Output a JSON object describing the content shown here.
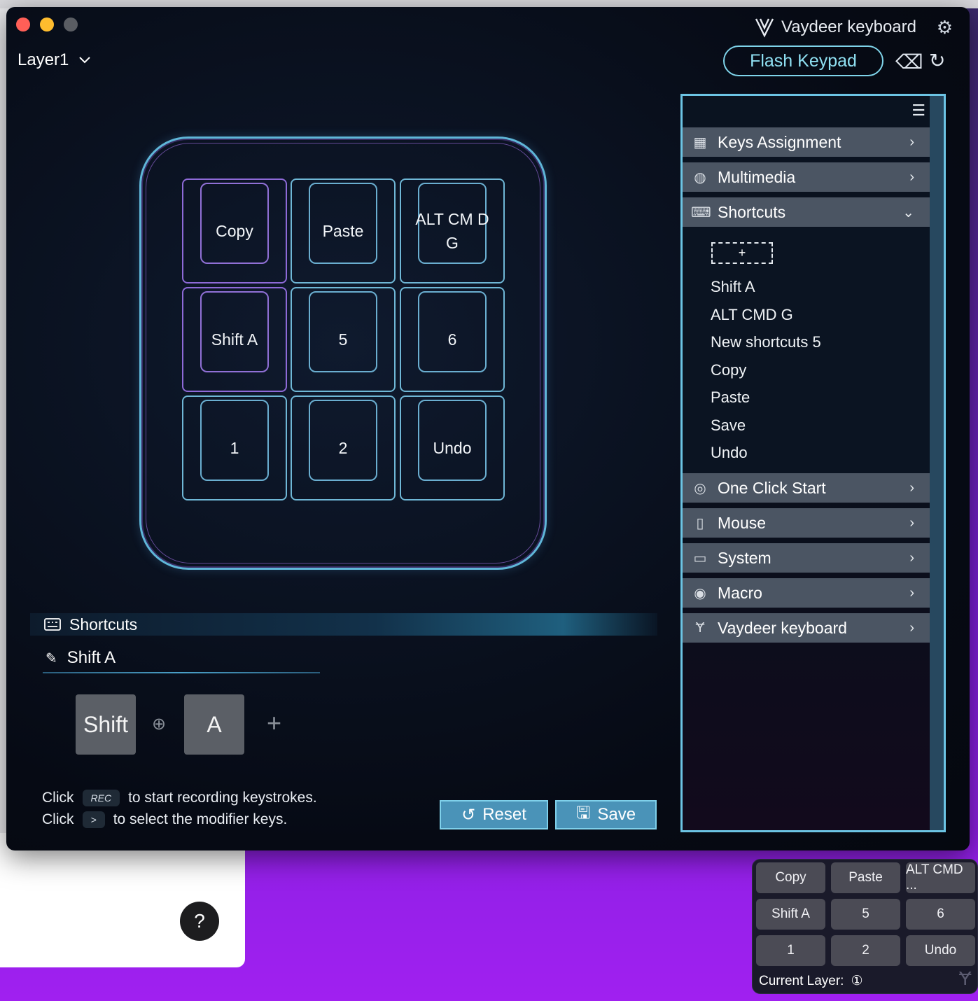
{
  "window": {
    "brand": "Vaydeer keyboard",
    "layer": "Layer1",
    "flash_button": "Flash Keypad"
  },
  "keypad": {
    "keys": [
      "Copy",
      "Paste",
      "ALT CM D G",
      "Shift A",
      "5",
      "6",
      "1",
      "2",
      "Undo"
    ]
  },
  "editor": {
    "header": "Shortcuts",
    "current_name": "Shift A",
    "keys": [
      "Shift",
      "A"
    ],
    "hint1_prefix": "Click",
    "hint1_chip": "REC",
    "hint1_suffix": "to start recording keystrokes.",
    "hint2_prefix": "Click",
    "hint2_chip": ">",
    "hint2_suffix": "to select the modifier keys.",
    "reset": "Reset",
    "save": "Save"
  },
  "panel": {
    "menu": [
      {
        "label": "Keys Assignment",
        "icon": "grid-icon"
      },
      {
        "label": "Multimedia",
        "icon": "multimedia-icon"
      },
      {
        "label": "Shortcuts",
        "icon": "keyboard-icon"
      },
      {
        "label": "One Click Start",
        "icon": "click-icon"
      },
      {
        "label": "Mouse",
        "icon": "mouse-icon"
      },
      {
        "label": "System",
        "icon": "monitor-icon"
      },
      {
        "label": "Macro",
        "icon": "macro-icon"
      },
      {
        "label": "Vaydeer keyboard",
        "icon": "vaydeer-logo-icon"
      }
    ],
    "shortcuts_add": "+",
    "shortcuts": [
      "Shift A",
      "ALT CMD G",
      "New shortcuts 5",
      "Copy",
      "Paste",
      "Save",
      "Undo"
    ]
  },
  "mini": {
    "keys": [
      "Copy",
      "Paste",
      "ALT CMD ...",
      "Shift A",
      "5",
      "6",
      "1",
      "2",
      "Undo"
    ],
    "current_layer_label": "Current Layer:",
    "current_layer_value": "①"
  },
  "help": "?"
}
